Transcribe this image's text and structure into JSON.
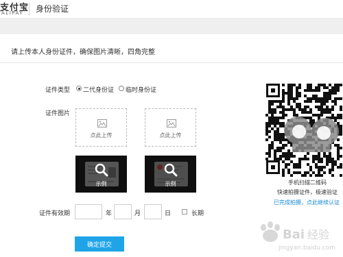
{
  "header": {
    "logo_cn": "支付宝",
    "logo_en": "ALIPAY",
    "title": "身份验证"
  },
  "instruction": "请上传本人身份证件，确保图片清晰，四角完整",
  "form": {
    "id_type_label": "证件类型",
    "id_types": [
      {
        "label": "二代身份证",
        "checked": true
      },
      {
        "label": "临时身份证",
        "checked": false
      }
    ],
    "id_image_label": "证件图片",
    "upload_label": "点此上传",
    "example_label": "示例",
    "validity_label": "证件有效期",
    "year_unit": "年",
    "month_unit": "月",
    "day_unit": "日",
    "long_term_label": "长期",
    "submit_label": "确定提交"
  },
  "qr": {
    "caption": "手机扫描二维码",
    "line2": "快速拍摄证件，极速验证",
    "line3": "已完成拍摄，点此继续认证"
  },
  "watermark": {
    "text": "Bai经验",
    "url": "jingyan.baidu.com"
  }
}
